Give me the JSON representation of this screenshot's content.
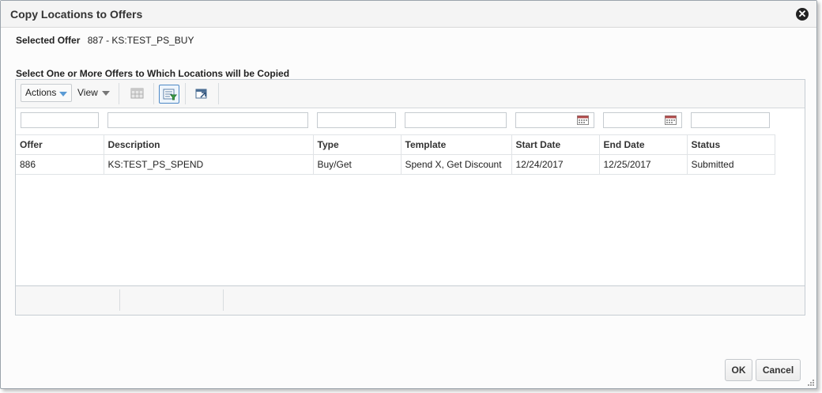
{
  "dialog": {
    "title": "Copy Locations to Offers",
    "close_icon": "close-icon"
  },
  "selected_offer": {
    "label": "Selected Offer",
    "value": "887 - KS:TEST_PS_BUY"
  },
  "section_title": "Select One or More Offers to Which Locations will be Copied",
  "toolbar": {
    "actions_label": "Actions",
    "view_label": "View",
    "icons": [
      "freeze-icon",
      "query-by-example-icon",
      "detach-icon"
    ]
  },
  "table": {
    "columns": [
      "Offer",
      "Description",
      "Type",
      "Template",
      "Start Date",
      "End Date",
      "Status"
    ],
    "rows": [
      [
        "886",
        "KS:TEST_PS_SPEND",
        "Buy/Get",
        "Spend X, Get Discount",
        "12/24/2017",
        "12/25/2017",
        "Submitted"
      ]
    ]
  },
  "footer": {
    "ok_label": "OK",
    "cancel_label": "Cancel"
  },
  "colors": {
    "accent": "#4e89c6",
    "title_bg": "#f4f4f4",
    "border": "#c6cdd3"
  }
}
